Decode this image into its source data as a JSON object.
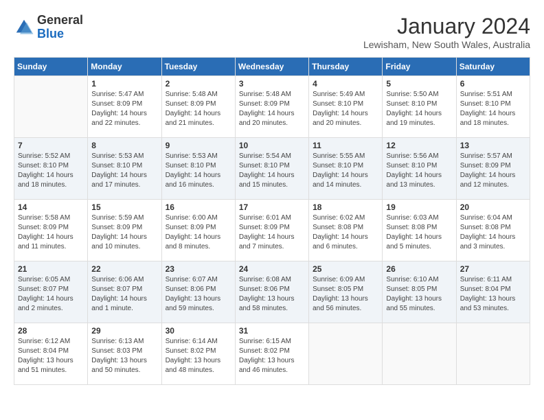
{
  "logo": {
    "general": "General",
    "blue": "Blue"
  },
  "title": "January 2024",
  "location": "Lewisham, New South Wales, Australia",
  "days_header": [
    "Sunday",
    "Monday",
    "Tuesday",
    "Wednesday",
    "Thursday",
    "Friday",
    "Saturday"
  ],
  "weeks": [
    [
      {
        "day": "",
        "info": ""
      },
      {
        "day": "1",
        "info": "Sunrise: 5:47 AM\nSunset: 8:09 PM\nDaylight: 14 hours\nand 22 minutes."
      },
      {
        "day": "2",
        "info": "Sunrise: 5:48 AM\nSunset: 8:09 PM\nDaylight: 14 hours\nand 21 minutes."
      },
      {
        "day": "3",
        "info": "Sunrise: 5:48 AM\nSunset: 8:09 PM\nDaylight: 14 hours\nand 20 minutes."
      },
      {
        "day": "4",
        "info": "Sunrise: 5:49 AM\nSunset: 8:10 PM\nDaylight: 14 hours\nand 20 minutes."
      },
      {
        "day": "5",
        "info": "Sunrise: 5:50 AM\nSunset: 8:10 PM\nDaylight: 14 hours\nand 19 minutes."
      },
      {
        "day": "6",
        "info": "Sunrise: 5:51 AM\nSunset: 8:10 PM\nDaylight: 14 hours\nand 18 minutes."
      }
    ],
    [
      {
        "day": "7",
        "info": "Sunrise: 5:52 AM\nSunset: 8:10 PM\nDaylight: 14 hours\nand 18 minutes."
      },
      {
        "day": "8",
        "info": "Sunrise: 5:53 AM\nSunset: 8:10 PM\nDaylight: 14 hours\nand 17 minutes."
      },
      {
        "day": "9",
        "info": "Sunrise: 5:53 AM\nSunset: 8:10 PM\nDaylight: 14 hours\nand 16 minutes."
      },
      {
        "day": "10",
        "info": "Sunrise: 5:54 AM\nSunset: 8:10 PM\nDaylight: 14 hours\nand 15 minutes."
      },
      {
        "day": "11",
        "info": "Sunrise: 5:55 AM\nSunset: 8:10 PM\nDaylight: 14 hours\nand 14 minutes."
      },
      {
        "day": "12",
        "info": "Sunrise: 5:56 AM\nSunset: 8:10 PM\nDaylight: 14 hours\nand 13 minutes."
      },
      {
        "day": "13",
        "info": "Sunrise: 5:57 AM\nSunset: 8:09 PM\nDaylight: 14 hours\nand 12 minutes."
      }
    ],
    [
      {
        "day": "14",
        "info": "Sunrise: 5:58 AM\nSunset: 8:09 PM\nDaylight: 14 hours\nand 11 minutes."
      },
      {
        "day": "15",
        "info": "Sunrise: 5:59 AM\nSunset: 8:09 PM\nDaylight: 14 hours\nand 10 minutes."
      },
      {
        "day": "16",
        "info": "Sunrise: 6:00 AM\nSunset: 8:09 PM\nDaylight: 14 hours\nand 8 minutes."
      },
      {
        "day": "17",
        "info": "Sunrise: 6:01 AM\nSunset: 8:09 PM\nDaylight: 14 hours\nand 7 minutes."
      },
      {
        "day": "18",
        "info": "Sunrise: 6:02 AM\nSunset: 8:08 PM\nDaylight: 14 hours\nand 6 minutes."
      },
      {
        "day": "19",
        "info": "Sunrise: 6:03 AM\nSunset: 8:08 PM\nDaylight: 14 hours\nand 5 minutes."
      },
      {
        "day": "20",
        "info": "Sunrise: 6:04 AM\nSunset: 8:08 PM\nDaylight: 14 hours\nand 3 minutes."
      }
    ],
    [
      {
        "day": "21",
        "info": "Sunrise: 6:05 AM\nSunset: 8:07 PM\nDaylight: 14 hours\nand 2 minutes."
      },
      {
        "day": "22",
        "info": "Sunrise: 6:06 AM\nSunset: 8:07 PM\nDaylight: 14 hours\nand 1 minute."
      },
      {
        "day": "23",
        "info": "Sunrise: 6:07 AM\nSunset: 8:06 PM\nDaylight: 13 hours\nand 59 minutes."
      },
      {
        "day": "24",
        "info": "Sunrise: 6:08 AM\nSunset: 8:06 PM\nDaylight: 13 hours\nand 58 minutes."
      },
      {
        "day": "25",
        "info": "Sunrise: 6:09 AM\nSunset: 8:05 PM\nDaylight: 13 hours\nand 56 minutes."
      },
      {
        "day": "26",
        "info": "Sunrise: 6:10 AM\nSunset: 8:05 PM\nDaylight: 13 hours\nand 55 minutes."
      },
      {
        "day": "27",
        "info": "Sunrise: 6:11 AM\nSunset: 8:04 PM\nDaylight: 13 hours\nand 53 minutes."
      }
    ],
    [
      {
        "day": "28",
        "info": "Sunrise: 6:12 AM\nSunset: 8:04 PM\nDaylight: 13 hours\nand 51 minutes."
      },
      {
        "day": "29",
        "info": "Sunrise: 6:13 AM\nSunset: 8:03 PM\nDaylight: 13 hours\nand 50 minutes."
      },
      {
        "day": "30",
        "info": "Sunrise: 6:14 AM\nSunset: 8:02 PM\nDaylight: 13 hours\nand 48 minutes."
      },
      {
        "day": "31",
        "info": "Sunrise: 6:15 AM\nSunset: 8:02 PM\nDaylight: 13 hours\nand 46 minutes."
      },
      {
        "day": "",
        "info": ""
      },
      {
        "day": "",
        "info": ""
      },
      {
        "day": "",
        "info": ""
      }
    ]
  ]
}
